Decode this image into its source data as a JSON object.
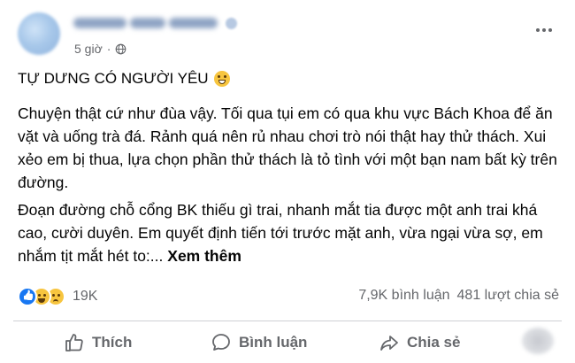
{
  "post": {
    "time": "5 giờ",
    "separator": "·",
    "title": "TỰ DƯNG CÓ NGƯỜI YÊU",
    "paragraph1": "Chuyện thật cứ như đùa vậy. Tối qua tụi em có qua khu vực Bách Khoa để ăn vặt và uống trà đá. Rảnh quá nên rủ nhau chơi trò nói thật hay thử thách. Xui xẻo em bị thua, lựa chọn phần thử thách là tỏ tình với một bạn nam bất kỳ trên đường.",
    "paragraph2": "Đoạn đường chỗ cổng BK thiếu gì trai, nhanh mắt tia được một anh trai khá cao, cười duyên. Em quyết định tiến tới trước mặt anh, vừa ngại vừa sợ, em nhắm tịt mắt hét to:...",
    "see_more": "Xem thêm"
  },
  "reactions": {
    "count": "19K",
    "comments": "7,9K bình luận",
    "shares": "481 lượt chia sẻ"
  },
  "actions": {
    "like": "Thích",
    "comment": "Bình luận",
    "share": "Chia sẻ"
  },
  "icons": {
    "privacy": "globe-icon",
    "more": "more-options-icon",
    "title_emoji": "blushing-face-icon"
  },
  "colors": {
    "text": "#050505",
    "muted": "#65676b",
    "like_blue": "#1877f2",
    "divider": "#ced0d4"
  }
}
